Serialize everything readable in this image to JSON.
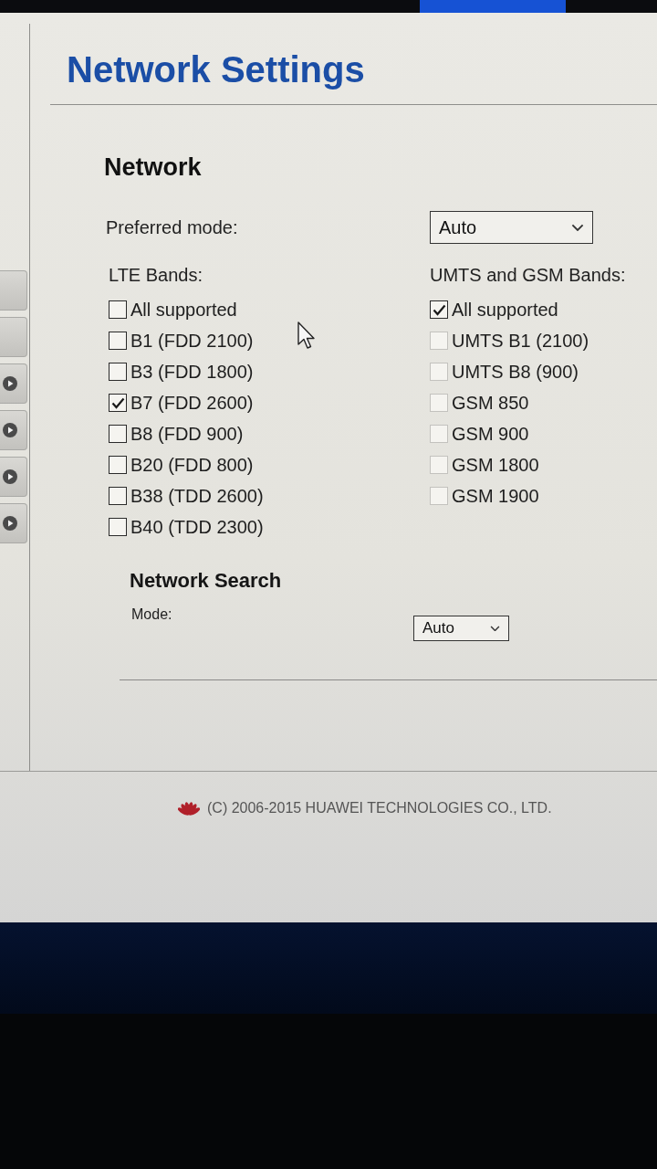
{
  "sidebar": {
    "items": [
      {
        "kind": "plain"
      },
      {
        "kind": "plain"
      },
      {
        "kind": "arrow"
      },
      {
        "kind": "arrow"
      },
      {
        "kind": "arrow"
      },
      {
        "kind": "arrow"
      }
    ]
  },
  "page": {
    "title": "Network Settings"
  },
  "network": {
    "heading": "Network",
    "preferred_mode": {
      "label": "Preferred mode:",
      "value": "Auto"
    },
    "lte_bands": {
      "label": "LTE Bands:",
      "options": [
        {
          "label": "All supported",
          "checked": false,
          "disabled": false
        },
        {
          "label": "B1 (FDD 2100)",
          "checked": false,
          "disabled": false
        },
        {
          "label": "B3 (FDD 1800)",
          "checked": false,
          "disabled": false
        },
        {
          "label": "B7 (FDD 2600)",
          "checked": true,
          "disabled": false
        },
        {
          "label": "B8 (FDD 900)",
          "checked": false,
          "disabled": false
        },
        {
          "label": "B20 (FDD 800)",
          "checked": false,
          "disabled": false
        },
        {
          "label": "B38 (TDD 2600)",
          "checked": false,
          "disabled": false
        },
        {
          "label": "B40 (TDD 2300)",
          "checked": false,
          "disabled": false
        }
      ]
    },
    "umts_gsm_bands": {
      "label": "UMTS and GSM Bands:",
      "options": [
        {
          "label": "All supported",
          "checked": true,
          "disabled": false
        },
        {
          "label": "UMTS B1 (2100)",
          "checked": false,
          "disabled": true
        },
        {
          "label": "UMTS B8 (900)",
          "checked": false,
          "disabled": true
        },
        {
          "label": "GSM 850",
          "checked": false,
          "disabled": true
        },
        {
          "label": "GSM 900",
          "checked": false,
          "disabled": true
        },
        {
          "label": "GSM 1800",
          "checked": false,
          "disabled": true
        },
        {
          "label": "GSM 1900",
          "checked": false,
          "disabled": true
        }
      ]
    }
  },
  "network_search": {
    "heading": "Network Search",
    "mode": {
      "label": "Mode:",
      "value": "Auto"
    }
  },
  "footer": {
    "copyright": "(C) 2006-2015 HUAWEI TECHNOLOGIES CO., LTD."
  }
}
